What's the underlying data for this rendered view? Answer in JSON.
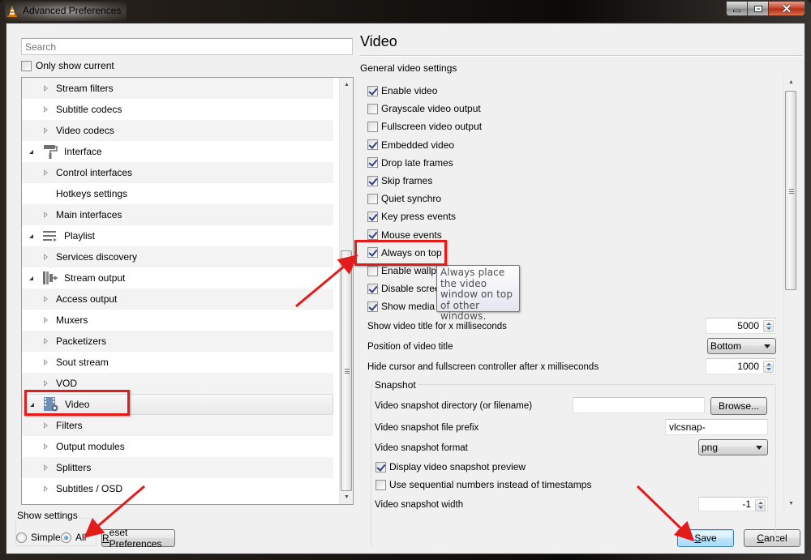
{
  "window": {
    "title": "Advanced Preferences",
    "controls": {
      "minimize": "minimize",
      "maximize": "maximize",
      "close": "close"
    }
  },
  "left_panel": {
    "search_placeholder": "Search",
    "only_show_current": {
      "label": "Only show current",
      "checked": false
    },
    "tree": [
      {
        "label": "Stream filters",
        "level": 1,
        "expander": "closed"
      },
      {
        "label": "Subtitle codecs",
        "level": 1,
        "expander": "closed"
      },
      {
        "label": "Video codecs",
        "level": 1,
        "expander": "closed"
      },
      {
        "label": "Interface",
        "level": 0,
        "expander": "open",
        "icon": "paint-roller-icon"
      },
      {
        "label": "Control interfaces",
        "level": 1,
        "expander": "closed"
      },
      {
        "label": "Hotkeys settings",
        "level": 1,
        "expander": "none"
      },
      {
        "label": "Main interfaces",
        "level": 1,
        "expander": "closed"
      },
      {
        "label": "Playlist",
        "level": 0,
        "expander": "open",
        "icon": "playlist-icon"
      },
      {
        "label": "Services discovery",
        "level": 1,
        "expander": "closed"
      },
      {
        "label": "Stream output",
        "level": 0,
        "expander": "open",
        "icon": "stream-output-icon"
      },
      {
        "label": "Access output",
        "level": 1,
        "expander": "closed"
      },
      {
        "label": "Muxers",
        "level": 1,
        "expander": "closed"
      },
      {
        "label": "Packetizers",
        "level": 1,
        "expander": "closed"
      },
      {
        "label": "Sout stream",
        "level": 1,
        "expander": "closed"
      },
      {
        "label": "VOD",
        "level": 1,
        "expander": "closed"
      },
      {
        "label": "Video",
        "level": 0,
        "expander": "open",
        "icon": "video-settings-icon",
        "selected": true
      },
      {
        "label": "Filters",
        "level": 1,
        "expander": "closed"
      },
      {
        "label": "Output modules",
        "level": 1,
        "expander": "closed"
      },
      {
        "label": "Splitters",
        "level": 1,
        "expander": "closed"
      },
      {
        "label": "Subtitles / OSD",
        "level": 1,
        "expander": "closed"
      }
    ]
  },
  "show_settings": {
    "legend": "Show settings",
    "options": [
      {
        "label": "Simple",
        "selected": false
      },
      {
        "label": "All",
        "selected": true
      }
    ]
  },
  "buttons": {
    "reset": {
      "accel": "R",
      "rest": "eset Preferences"
    },
    "save": {
      "accel": "S",
      "rest": "ave"
    },
    "cancel": {
      "accel": "C",
      "rest": "ancel"
    },
    "browse": "Browse..."
  },
  "right_panel": {
    "title": "Video",
    "section": "General video settings",
    "checkboxes": [
      {
        "label": "Enable video",
        "checked": true
      },
      {
        "label": "Grayscale video output",
        "checked": false
      },
      {
        "label": "Fullscreen video output",
        "checked": false
      },
      {
        "label": "Embedded video",
        "checked": true
      },
      {
        "label": "Drop late frames",
        "checked": true
      },
      {
        "label": "Skip frames",
        "checked": true
      },
      {
        "label": "Quiet synchro",
        "checked": false
      },
      {
        "label": "Key press events",
        "checked": true
      },
      {
        "label": "Mouse events",
        "checked": true
      },
      {
        "label": "Always on top",
        "checked": true
      },
      {
        "label": "Enable wallpap",
        "checked": false
      },
      {
        "label": "Disable screen",
        "checked": true
      },
      {
        "label": "Show media tit",
        "checked": true
      }
    ],
    "tooltip": "Always place the video window on top of other windows.",
    "fields": {
      "show_title_ms": {
        "label": "Show video title for x milliseconds",
        "value": "5000"
      },
      "title_position": {
        "label": "Position of video title",
        "value": "Bottom"
      },
      "hide_cursor_ms": {
        "label": "Hide cursor and fullscreen controller after x milliseconds",
        "value": "1000"
      }
    },
    "snapshot": {
      "legend": "Snapshot",
      "directory": {
        "label": "Video snapshot directory (or filename)",
        "value": ""
      },
      "prefix": {
        "label": "Video snapshot file prefix",
        "value": "vlcsnap-"
      },
      "format": {
        "label": "Video snapshot format",
        "value": "png"
      },
      "display_preview": {
        "label": "Display video snapshot preview",
        "checked": true
      },
      "sequential": {
        "label": "Use sequential numbers instead of timestamps",
        "checked": false
      },
      "width": {
        "label": "Video snapshot width",
        "value": "-1"
      }
    }
  },
  "annotation_color": "#e31b1b"
}
